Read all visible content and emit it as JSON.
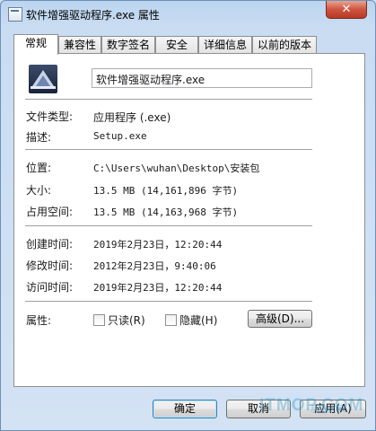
{
  "window": {
    "title": "软件增强驱动程序.exe 属性",
    "close_glyph": "✕"
  },
  "tabs": [
    {
      "label": "常规"
    },
    {
      "label": "兼容性"
    },
    {
      "label": "数字签名"
    },
    {
      "label": "安全"
    },
    {
      "label": "详细信息"
    },
    {
      "label": "以前的版本"
    }
  ],
  "general": {
    "file_name": "软件增强驱动程序.exe",
    "file_type_label": "文件类型:",
    "file_type_value": "应用程序 (.exe)",
    "description_label": "描述:",
    "description_value": "Setup.exe",
    "location_label": "位置:",
    "location_value": "C:\\Users\\wuhan\\Desktop\\安装包",
    "size_label": "大小:",
    "size_value": "13.5 MB (14,161,896 字节)",
    "size_on_disk_label": "占用空间:",
    "size_on_disk_value": "13.5 MB (14,163,968 字节)",
    "created_label": "创建时间:",
    "created_value": "2019年2月23日，12:20:44",
    "modified_label": "修改时间:",
    "modified_value": "2012年2月23日，9:40:06",
    "accessed_label": "访问时间:",
    "accessed_value": "2019年2月23日，12:20:44",
    "attributes_label": "属性:",
    "readonly_label": "只读(R)",
    "hidden_label": "隐藏(H)",
    "advanced_label": "高级(D)..."
  },
  "footer": {
    "ok_label": "确定",
    "cancel_label": "取消",
    "apply_label": "应用(A)"
  },
  "watermark": {
    "text": "ITMOP.COM",
    "sub": "系统之家"
  },
  "colors": {
    "title_bg": "#c9dcf2",
    "close_btn": "#d0543f",
    "accent": "#3c7fb1"
  }
}
